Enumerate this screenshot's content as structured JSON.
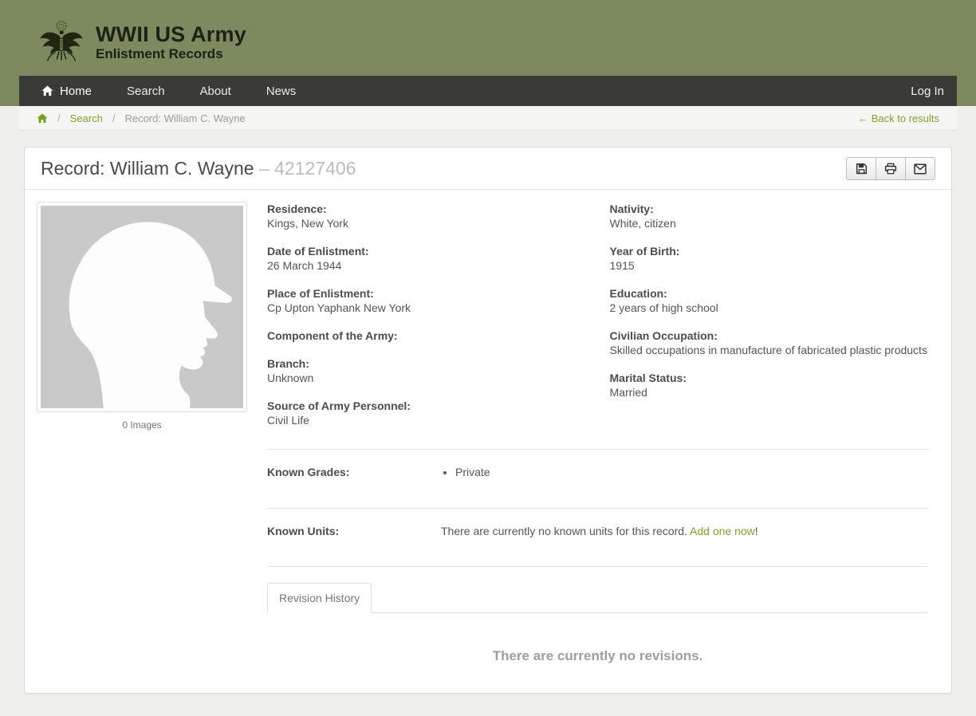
{
  "brand": {
    "title": "WWII US Army",
    "subtitle": "Enlistment Records"
  },
  "nav": {
    "home": "Home",
    "search": "Search",
    "about": "About",
    "news": "News",
    "login": "Log In"
  },
  "breadcrumb": {
    "separator": "/",
    "search": "Search",
    "current": "Record: William C. Wayne",
    "back": "← Back to results"
  },
  "record": {
    "title": "Record: William C. Wayne",
    "dash": "–",
    "serial": "42127406",
    "images_caption": "0 Images",
    "fields_left": [
      {
        "label": "Residence:",
        "value": "Kings, New York"
      },
      {
        "label": "Date of Enlistment:",
        "value": "26 March 1944"
      },
      {
        "label": "Place of Enlistment:",
        "value": "Cp Upton Yaphank New York"
      },
      {
        "label": "Component of the Army:",
        "value": ""
      },
      {
        "label": "Branch:",
        "value": "Unknown"
      },
      {
        "label": "Source of Army Personnel:",
        "value": "Civil Life"
      }
    ],
    "fields_right": [
      {
        "label": "Nativity:",
        "value": "White, citizen"
      },
      {
        "label": "Year of Birth:",
        "value": "1915"
      },
      {
        "label": "Education:",
        "value": "2 years of high school"
      },
      {
        "label": "Civilian Occupation:",
        "value": "Skilled occupations in manufacture of fabricated plastic products"
      },
      {
        "label": "Marital Status:",
        "value": "Married"
      }
    ],
    "known_grades_label": "Known Grades:",
    "known_grades": [
      "Private"
    ],
    "known_units_label": "Known Units:",
    "known_units_text": "There are currently no known units for this record. ",
    "known_units_link": "Add one now",
    "known_units_suffix": "!",
    "tab_revision_history": "Revision History",
    "revisions_empty": "There are currently no revisions."
  },
  "icons": {
    "brand": "us-great-seal-eagle",
    "nav_home": "home",
    "breadcrumb_home": "home",
    "toolbar": [
      "floppy-save",
      "printer",
      "envelope"
    ],
    "photo_placeholder": "soldier-silhouette"
  },
  "colors": {
    "header_olive": "#7d8a5f",
    "navbar_dark": "#3a3a38",
    "accent_green": "#7da32c",
    "title_gray": "#4a4a4a",
    "serial_gray": "#bcbcbc",
    "muted_gray": "#9e9e9e",
    "photo_bg": "#c9c9c9"
  }
}
